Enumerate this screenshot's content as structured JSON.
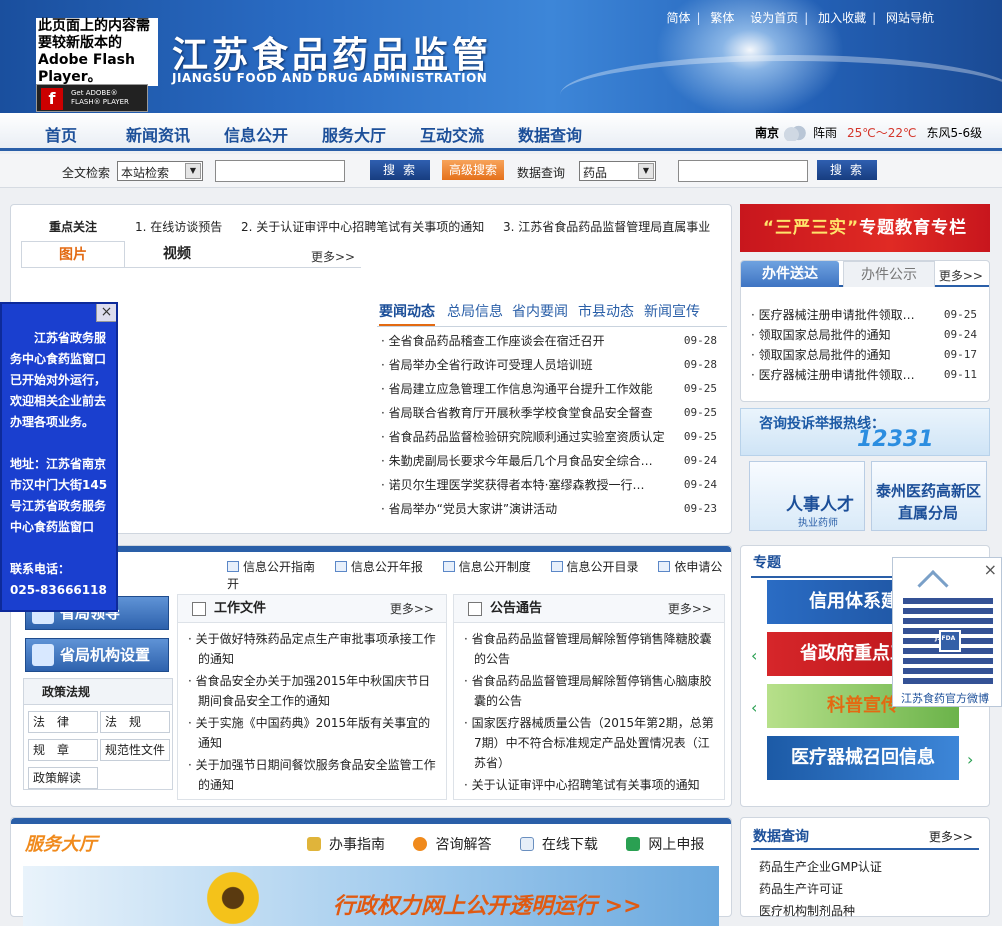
{
  "header": {
    "flash_note": "此页面上的内容需要较新版本的 Adobe Flash Player。",
    "flash_badge_line1": "Get ADOBE®",
    "flash_badge_line2": "FLASH® PLAYER",
    "logo_cn": "江苏食品药品监管",
    "logo_en": "JIANGSU FOOD AND DRUG ADMINISTRATION",
    "toplinks": [
      "简体",
      "繁体",
      "设为首页",
      "加入收藏",
      "网站导航"
    ]
  },
  "nav": {
    "items": [
      "首页",
      "新闻资讯",
      "信息公开",
      "服务大厅",
      "互动交流",
      "数据查询"
    ],
    "weather": {
      "city": "南京",
      "condition": "阵雨",
      "temp": "25℃～22℃",
      "wind": "东风5-6级"
    }
  },
  "search": {
    "label1": "全文检索",
    "scope": "本站检索",
    "btn1": "搜索",
    "advanced": "高级搜索",
    "label2": "数据查询",
    "category": "药品",
    "btn2": "搜索"
  },
  "focus": {
    "title": "重点关注",
    "items": [
      "1. 在线访谈预告",
      "2. 关于认证审评中心招聘笔试有关事项的通知",
      "3. 江苏省食品药品监督管理局直属事业"
    ]
  },
  "media_tabs": {
    "pic": "图片",
    "video": "视频",
    "more": "更多>>"
  },
  "news": {
    "tabs": [
      "要闻动态",
      "总局信息",
      "省内要闻",
      "市县动态",
      "新闻宣传"
    ],
    "items": [
      {
        "title": "· 全省食品药品稽查工作座谈会在宿迁召开",
        "date": "09-28"
      },
      {
        "title": "· 省局举办全省行政许可受理人员培训班",
        "date": "09-28"
      },
      {
        "title": "· 省局建立应急管理工作信息沟通平台提升工作效能",
        "date": "09-25"
      },
      {
        "title": "· 省局联合省教育厅开展秋季学校食堂食品安全督查",
        "date": "09-25"
      },
      {
        "title": "· 省食品药品监督检验研究院顺利通过实验室资质认定",
        "date": "09-25"
      },
      {
        "title": "· 朱勤虎副局长要求今年最后几个月食品安全综合…",
        "date": "09-24"
      },
      {
        "title": "· 诺贝尔生理医学奖获得者本特·塞缪森教授一行…",
        "date": "09-24"
      },
      {
        "title": "· 省局举办“党员大家讲”演讲活动",
        "date": "09-23"
      }
    ]
  },
  "floater": {
    "close": "×",
    "line1": "江苏省政务服务中心食药监窗口已开始对外运行，欢迎相关企业前去办理各项业务。",
    "line2": "地址：江苏省南京市汉中门大街145号江苏省政务服务中心食药监窗口",
    "line3": "联系电话：",
    "phone": "025-83666118"
  },
  "info": {
    "links": [
      "信息公开指南",
      "信息公开年报",
      "信息公开制度",
      "信息公开目录",
      "依申请公开"
    ],
    "side_buttons": [
      "省局领导",
      "省局机构设置"
    ],
    "policy": {
      "title": "政策法规",
      "items": [
        "法　律",
        "法　规",
        "规　章",
        "规范性文件",
        "政策解读"
      ]
    },
    "work": {
      "title": "工作文件",
      "more": "更多>>",
      "items": [
        "· 关于做好特殊药品定点生产审批事项承接工作的通知",
        "· 省食品安全办关于加强2015年中秋国庆节日期间食品安全工作的通知",
        "· 关于实施《中国药典》2015年版有关事宜的通知",
        "· 关于加强节日期间餐饮服务食品安全监管工作的通知"
      ]
    },
    "notice": {
      "title": "公告通告",
      "more": "更多>>",
      "items": [
        "· 省食品药品监督管理局解除暂停销售降糖胶囊的公告",
        "· 省食品药品监督管理局解除暂停销售心脑康胶囊的公告",
        "· 国家医疗器械质量公告（2015年第2期，总第7期）中不符合标准规定产品处置情况表（江苏省）",
        "· 关于认证审评中心招聘笔试有关事项的通知"
      ]
    }
  },
  "service": {
    "title": "服务大厅",
    "links": [
      "办事指南",
      "咨询解答",
      "在线下载",
      "网上申报"
    ],
    "banner": "行政权力网上公开透明运行 >>"
  },
  "right": {
    "banner_quote": "“三严三实”",
    "banner_text": "专题教育专栏",
    "biz_tabs": [
      "办件送达",
      "办件公示"
    ],
    "biz_more": "更多>>",
    "biz_items": [
      {
        "title": "· 医疗器械注册申请批件领取通知",
        "date": "09-25"
      },
      {
        "title": "· 领取国家总局批件的通知",
        "date": "09-24"
      },
      {
        "title": "· 领取国家总局批件的通知",
        "date": "09-17"
      },
      {
        "title": "· 医疗器械注册申请批件领取通知",
        "date": "09-11"
      }
    ],
    "hotline_label": "咨询投诉举报热线：",
    "hotline_number": "12331",
    "tile1_title": "人事人才",
    "tile1_sub": "执业药师",
    "tile2_line1": "泰州医药高新区",
    "tile2_line2": "直属分局",
    "topics_title": "专题",
    "topics_more": "更多>>",
    "topics": [
      "信用体系建设",
      "省政府重点工作",
      "科普宣传",
      "医疗器械召回信息"
    ],
    "qr_close": "×",
    "qr_label": "江苏食药官方微博",
    "qr_code_text": "JSFDA",
    "data_title": "数据查询",
    "data_more": "更多>>",
    "data_items": [
      "药品生产企业GMP认证",
      "药品生产许可证",
      "医疗机构制剂品种"
    ]
  }
}
